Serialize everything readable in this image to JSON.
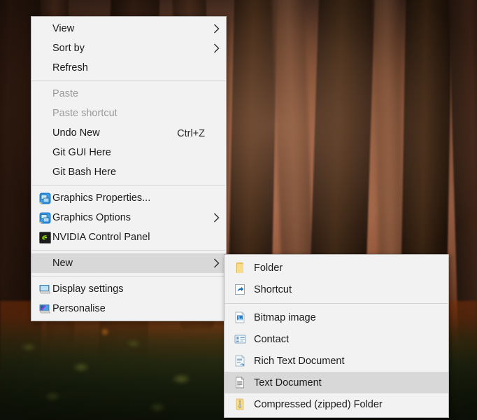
{
  "desktop": {
    "wallpaper_description": "Foggy autumn beech forest with dark tree trunks and orange leaf ground",
    "colors": {
      "menu_background": "#f2f2f2",
      "menu_border": "#b4b4b4",
      "menu_separator": "#d3d3d3",
      "highlight": "#d8d8d8",
      "text": "#1a1a1a",
      "text_disabled": "#9a9a9a"
    }
  },
  "context_menu": {
    "name": "desktop-context-menu",
    "groups": [
      {
        "items": [
          {
            "label": "View",
            "icon": "none",
            "submenu": true,
            "disabled": false,
            "selected": false,
            "accel": ""
          },
          {
            "label": "Sort by",
            "icon": "none",
            "submenu": true,
            "disabled": false,
            "selected": false,
            "accel": ""
          },
          {
            "label": "Refresh",
            "icon": "none",
            "submenu": false,
            "disabled": false,
            "selected": false,
            "accel": ""
          }
        ]
      },
      {
        "items": [
          {
            "label": "Paste",
            "icon": "none",
            "submenu": false,
            "disabled": true,
            "selected": false,
            "accel": ""
          },
          {
            "label": "Paste shortcut",
            "icon": "none",
            "submenu": false,
            "disabled": true,
            "selected": false,
            "accel": ""
          },
          {
            "label": "Undo New",
            "icon": "none",
            "submenu": false,
            "disabled": false,
            "selected": false,
            "accel": "Ctrl+Z"
          },
          {
            "label": "Git GUI Here",
            "icon": "none",
            "submenu": false,
            "disabled": false,
            "selected": false,
            "accel": ""
          },
          {
            "label": "Git Bash Here",
            "icon": "none",
            "submenu": false,
            "disabled": false,
            "selected": false,
            "accel": ""
          }
        ]
      },
      {
        "items": [
          {
            "label": "Graphics Properties...",
            "icon": "intel-graphics-icon",
            "submenu": false,
            "disabled": false,
            "selected": false,
            "accel": ""
          },
          {
            "label": "Graphics Options",
            "icon": "intel-graphics-icon",
            "submenu": true,
            "disabled": false,
            "selected": false,
            "accel": ""
          },
          {
            "label": "NVIDIA Control Panel",
            "icon": "nvidia-icon",
            "submenu": false,
            "disabled": false,
            "selected": false,
            "accel": ""
          }
        ]
      },
      {
        "items": [
          {
            "label": "New",
            "icon": "none",
            "submenu": true,
            "disabled": false,
            "selected": true,
            "accel": ""
          }
        ]
      },
      {
        "items": [
          {
            "label": "Display settings",
            "icon": "display-settings-icon",
            "submenu": false,
            "disabled": false,
            "selected": false,
            "accel": ""
          },
          {
            "label": "Personalise",
            "icon": "personalise-icon",
            "submenu": false,
            "disabled": false,
            "selected": false,
            "accel": ""
          }
        ]
      }
    ]
  },
  "new_submenu": {
    "name": "new-submenu",
    "groups": [
      {
        "items": [
          {
            "label": "Folder",
            "icon": "folder-icon",
            "selected": false
          },
          {
            "label": "Shortcut",
            "icon": "shortcut-icon",
            "selected": false
          }
        ]
      },
      {
        "items": [
          {
            "label": "Bitmap image",
            "icon": "bitmap-image-icon",
            "selected": false
          },
          {
            "label": "Contact",
            "icon": "contact-icon",
            "selected": false
          },
          {
            "label": "Rich Text Document",
            "icon": "rich-text-icon",
            "selected": false
          },
          {
            "label": "Text Document",
            "icon": "text-document-icon",
            "selected": true
          },
          {
            "label": "Compressed (zipped) Folder",
            "icon": "zip-folder-icon",
            "selected": false
          }
        ]
      }
    ]
  }
}
